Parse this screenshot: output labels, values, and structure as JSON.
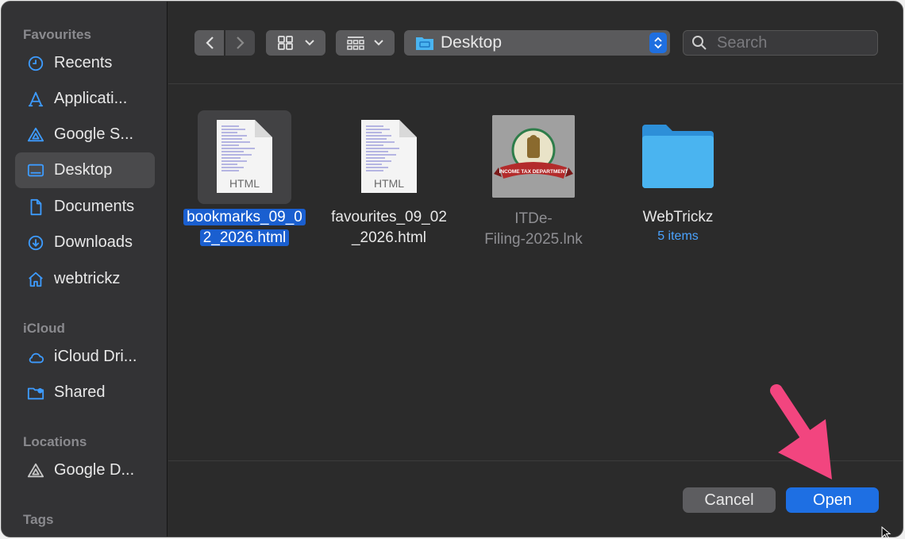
{
  "sidebar": {
    "sections": [
      {
        "title": "Favourites",
        "items": [
          {
            "label": "Recents",
            "icon": "clock-icon"
          },
          {
            "label": "Applicati...",
            "icon": "applications-icon"
          },
          {
            "label": "Google S...",
            "icon": "google-drive-icon"
          },
          {
            "label": "Desktop",
            "icon": "desktop-icon",
            "selected": true
          },
          {
            "label": "Documents",
            "icon": "document-icon"
          },
          {
            "label": "Downloads",
            "icon": "download-icon"
          },
          {
            "label": "webtrickz",
            "icon": "home-icon"
          }
        ]
      },
      {
        "title": "iCloud",
        "items": [
          {
            "label": "iCloud Dri...",
            "icon": "cloud-icon"
          },
          {
            "label": "Shared",
            "icon": "shared-folder-icon"
          }
        ]
      },
      {
        "title": "Locations",
        "items": [
          {
            "label": "Google D...",
            "icon": "drive-disk-icon"
          }
        ]
      },
      {
        "title": "Tags",
        "items": []
      }
    ]
  },
  "toolbar": {
    "path_label": "Desktop",
    "search_placeholder": "Search"
  },
  "files": [
    {
      "name_line1": "bookmarks_09_0",
      "name_line2": "2_2026.html",
      "type_label": "HTML",
      "selected": true
    },
    {
      "name_line1": "favourites_09_02",
      "name_line2": "_2026.html",
      "type_label": "HTML"
    },
    {
      "name_line1": "ITDe-",
      "name_line2": "Filing-2025.lnk",
      "emblem_text": "INCOME TAX DEPARTMENT"
    },
    {
      "name_line1": "WebTrickz",
      "sub": "5 items"
    }
  ],
  "buttons": {
    "cancel": "Cancel",
    "open": "Open"
  },
  "colors": {
    "accent": "#1e6fe3",
    "arrow": "#f2457f",
    "folder": "#4ab4f0"
  }
}
